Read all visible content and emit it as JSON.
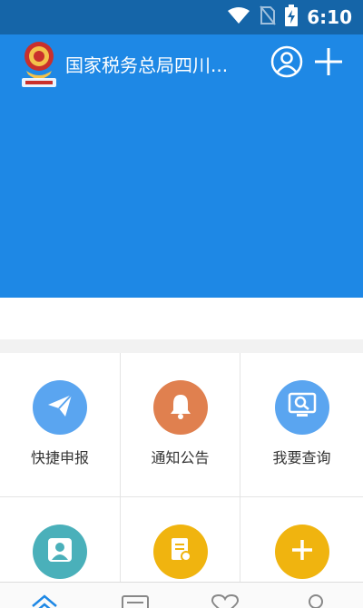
{
  "status_bar": {
    "time": "6:10",
    "icons": [
      "wifi-icon",
      "no-sim-icon",
      "battery-charging-icon"
    ]
  },
  "header": {
    "title": "国家税务总局四川...",
    "logo_icon": "tax-emblem-icon",
    "profile_icon": "user-circle-icon",
    "add_icon": "plus-icon"
  },
  "services": [
    {
      "label": "快捷申报",
      "icon": "paper-plane-icon",
      "color": "#5aa5f0"
    },
    {
      "label": "通知公告",
      "icon": "bell-icon",
      "color": "#e0804f"
    },
    {
      "label": "我要查询",
      "icon": "search-monitor-icon",
      "color": "#5aa5f0"
    },
    {
      "label": "",
      "icon": "person-icon",
      "color": "#4ab0ba"
    },
    {
      "label": "",
      "icon": "document-icon",
      "color": "#f0b40f"
    },
    {
      "label": "",
      "icon": "plus-icon",
      "color": "#f0b40f"
    }
  ],
  "bottom_nav": {
    "icons": [
      "home-icon",
      "list-icon",
      "heart-icon",
      "profile-icon"
    ],
    "active_color": "#1e88e5"
  },
  "colors": {
    "header_blue": "#1e88e5",
    "status_blue": "#1565a8"
  }
}
